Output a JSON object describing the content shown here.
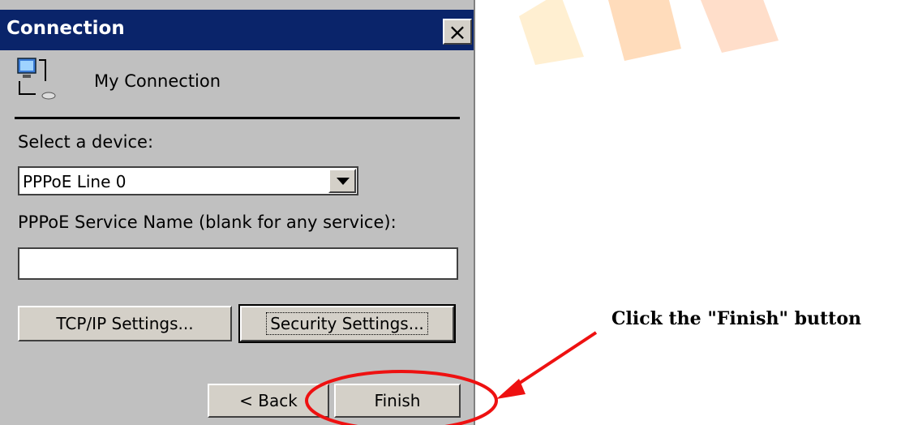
{
  "window": {
    "title": "Connection",
    "close_label": "×",
    "connection_name": "My Connection"
  },
  "form": {
    "device_label": "Select a device:",
    "device_value": "PPPoE Line 0",
    "service_label": "PPPoE Service Name (blank for any service):",
    "service_value": ""
  },
  "buttons": {
    "tcpip": "TCP/IP Settings...",
    "security": "Security Settings...",
    "back": "< Back",
    "finish": "Finish"
  },
  "annotation": {
    "text": "Click the \"Finish\" button"
  },
  "colors": {
    "titlebar": "#0a246a",
    "dialog_bg": "#c0c0c0",
    "annotation_red": "#ee1111",
    "watermark": "#f5b000"
  },
  "icons": [
    "network-connection-icon",
    "close-icon",
    "dropdown-arrow-icon",
    "annotation-arrow-icon",
    "highlight-ellipse-icon"
  ]
}
